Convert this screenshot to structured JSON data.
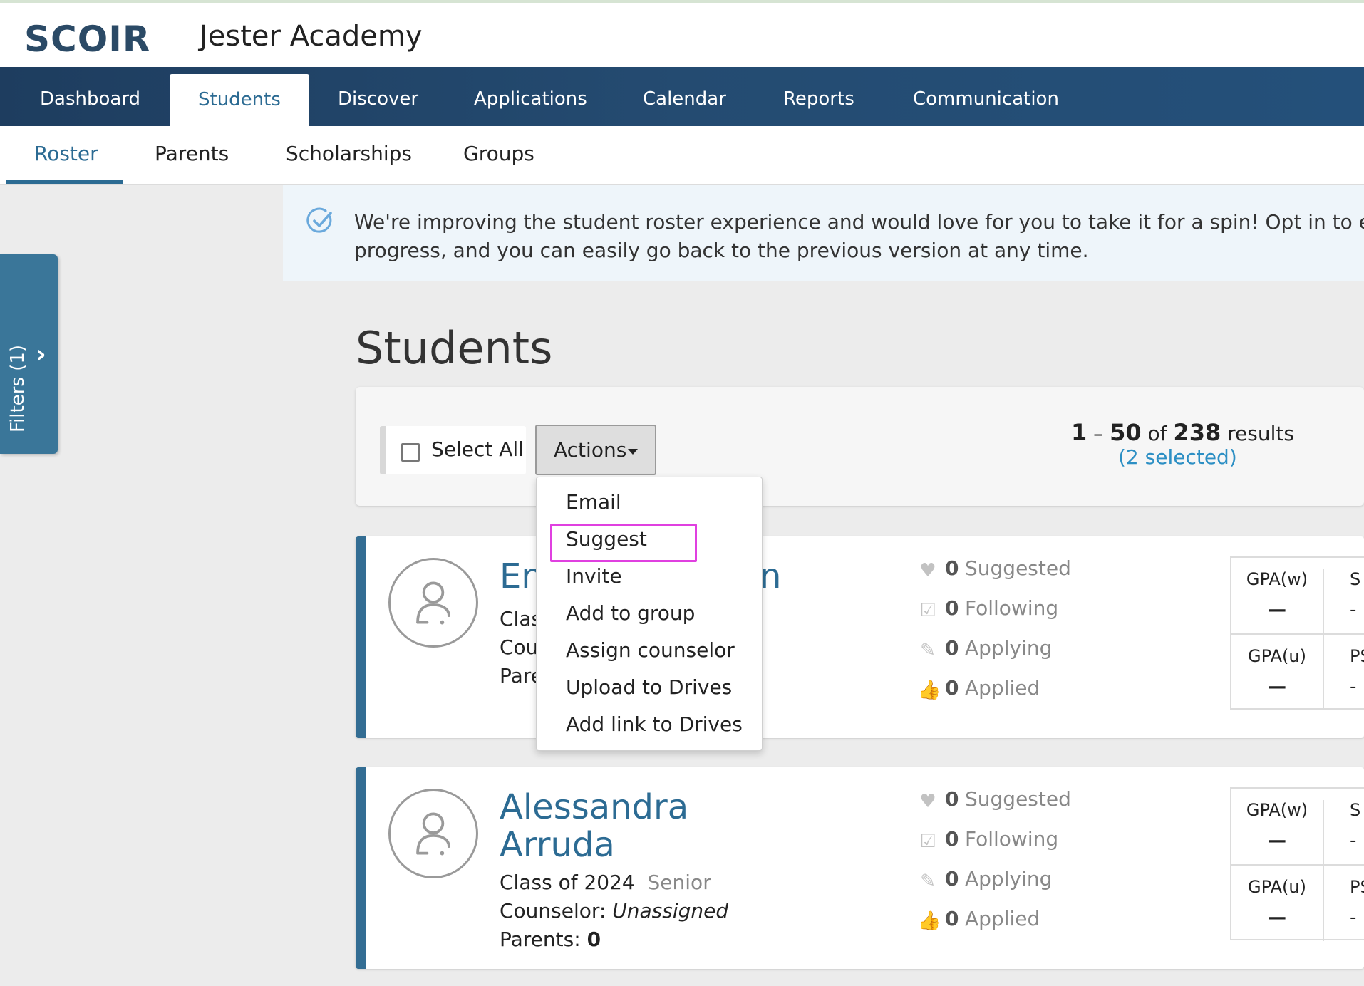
{
  "header": {
    "logo": "SCOIR",
    "school_name": "Jester Academy"
  },
  "nav": {
    "items": [
      {
        "label": "Dashboard"
      },
      {
        "label": "Students"
      },
      {
        "label": "Discover"
      },
      {
        "label": "Applications"
      },
      {
        "label": "Calendar"
      },
      {
        "label": "Reports"
      },
      {
        "label": "Communication"
      }
    ],
    "active": "Students"
  },
  "subnav": {
    "items": [
      {
        "label": "Roster"
      },
      {
        "label": "Parents"
      },
      {
        "label": "Scholarships"
      },
      {
        "label": "Groups"
      }
    ],
    "active": "Roster"
  },
  "filters": {
    "label": "Filters (1)"
  },
  "banner": {
    "line1": "We're improving the student roster experience and would love for you to take it for a spin! Opt in to explor",
    "line2": "progress, and you can easily go back to the previous version at any time."
  },
  "page": {
    "title": "Students"
  },
  "toolbar": {
    "select_all_label": "Select All",
    "actions_label": "Actions",
    "results_start": "1",
    "results_sep": "–",
    "results_end": "50",
    "results_of": "of",
    "results_total": "238",
    "results_word": "results",
    "selected_text": "(2 selected)"
  },
  "actions_menu": {
    "items": [
      {
        "label": "Email"
      },
      {
        "label": "Suggest"
      },
      {
        "label": "Invite"
      },
      {
        "label": "Add to group"
      },
      {
        "label": "Assign counselor"
      },
      {
        "label": "Upload to Drives"
      },
      {
        "label": "Add link to Drives"
      }
    ],
    "highlighted": "Suggest"
  },
  "students": [
    {
      "name_line1": "En",
      "name_line2": "",
      "name_tail": "n",
      "class_of": "Clas",
      "year_status": "",
      "counselor_label": "Cou",
      "counselor_value": "",
      "parents_label": "Pare",
      "parents_value": "",
      "stats": {
        "suggested": "0",
        "following": "0",
        "applying": "0",
        "applied": "0"
      },
      "gpa": {
        "w_label": "GPA(w)",
        "w_value": "—",
        "u_label": "GPA(u)",
        "u_value": "—",
        "col2_top": "S",
        "col2_bottom": "PS",
        "col2_top_value": "-",
        "col2_bottom_value": "-"
      }
    },
    {
      "name_line1": "Alessandra",
      "name_line2": "Arruda",
      "class_of": "Class of 2024",
      "year_status": "Senior",
      "counselor_label": "Counselor:",
      "counselor_value": "Unassigned",
      "parents_label": "Parents:",
      "parents_value": "0",
      "stats": {
        "suggested": "0",
        "following": "0",
        "applying": "0",
        "applied": "0"
      },
      "gpa": {
        "w_label": "GPA(w)",
        "w_value": "—",
        "u_label": "GPA(u)",
        "u_value": "—",
        "col2_top": "S",
        "col2_bottom": "PS",
        "col2_top_value": "-",
        "col2_bottom_value": "-"
      }
    }
  ],
  "stat_labels": {
    "suggested": "Suggested",
    "following": "Following",
    "applying": "Applying",
    "applied": "Applied"
  },
  "icons": {
    "suggested": "heart-icon",
    "following": "checkbox-icon",
    "applying": "pencil-icon",
    "applied": "thumbs-up-icon",
    "banner": "check-circle-icon",
    "avatar": "user-icon",
    "filters": "chevron-right-icon"
  },
  "colors": {
    "brand": "#2b4a66",
    "nav_bg": "#1e3d5f",
    "accent": "#2c6b93",
    "link": "#2c8fc4",
    "highlight": "#e040e0"
  }
}
